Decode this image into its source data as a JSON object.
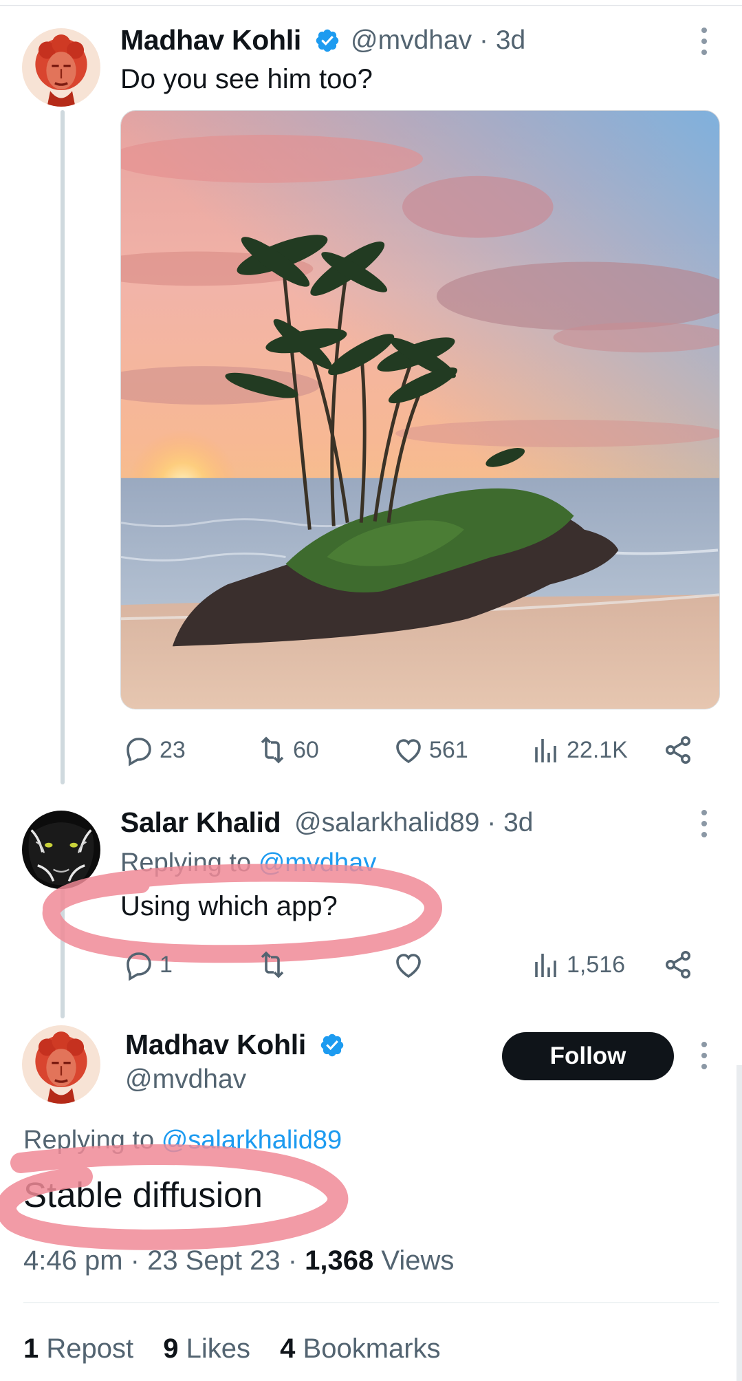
{
  "tweet1": {
    "author_name": "Madhav Kohli",
    "handle": "@mvdhav",
    "time": "· 3d",
    "text": "Do you see him too?",
    "replies": "23",
    "reposts": "60",
    "likes": "561",
    "views": "22.1K"
  },
  "tweet2": {
    "author_name": "Salar Khalid",
    "handle": "@salarkhalid89",
    "time": "· 3d",
    "replying_label": "Replying to",
    "replying_to": "@mvdhav",
    "text": "Using which app?",
    "replies": "1",
    "views": "1,516"
  },
  "tweet3": {
    "author_name": "Madhav Kohli",
    "handle": "@mvdhav",
    "follow_label": "Follow",
    "replying_label": "Replying to",
    "replying_to": "@salarkhalid89",
    "text": "Stable diffusion",
    "timestamp": "4:46 pm · 23 Sept 23 ·",
    "views_count": "1,368",
    "views_label": "Views",
    "reposts_count": "1",
    "reposts_label": "Repost",
    "likes_count": "9",
    "likes_label": "Likes",
    "bookmarks_count": "4",
    "bookmarks_label": "Bookmarks"
  },
  "icons": {
    "reply": "speech-bubble-icon",
    "repost": "repost-arrows-icon",
    "like": "heart-icon",
    "views": "bar-chart-icon",
    "share": "share-nodes-icon",
    "verified": "verified-badge-icon",
    "more": "vertical-ellipsis-icon"
  },
  "colors": {
    "accent": "#1d9bf0",
    "text": "#0f1419",
    "secondary": "#536471",
    "highlight": "#f08a96",
    "follow_button": "#0f1419"
  }
}
